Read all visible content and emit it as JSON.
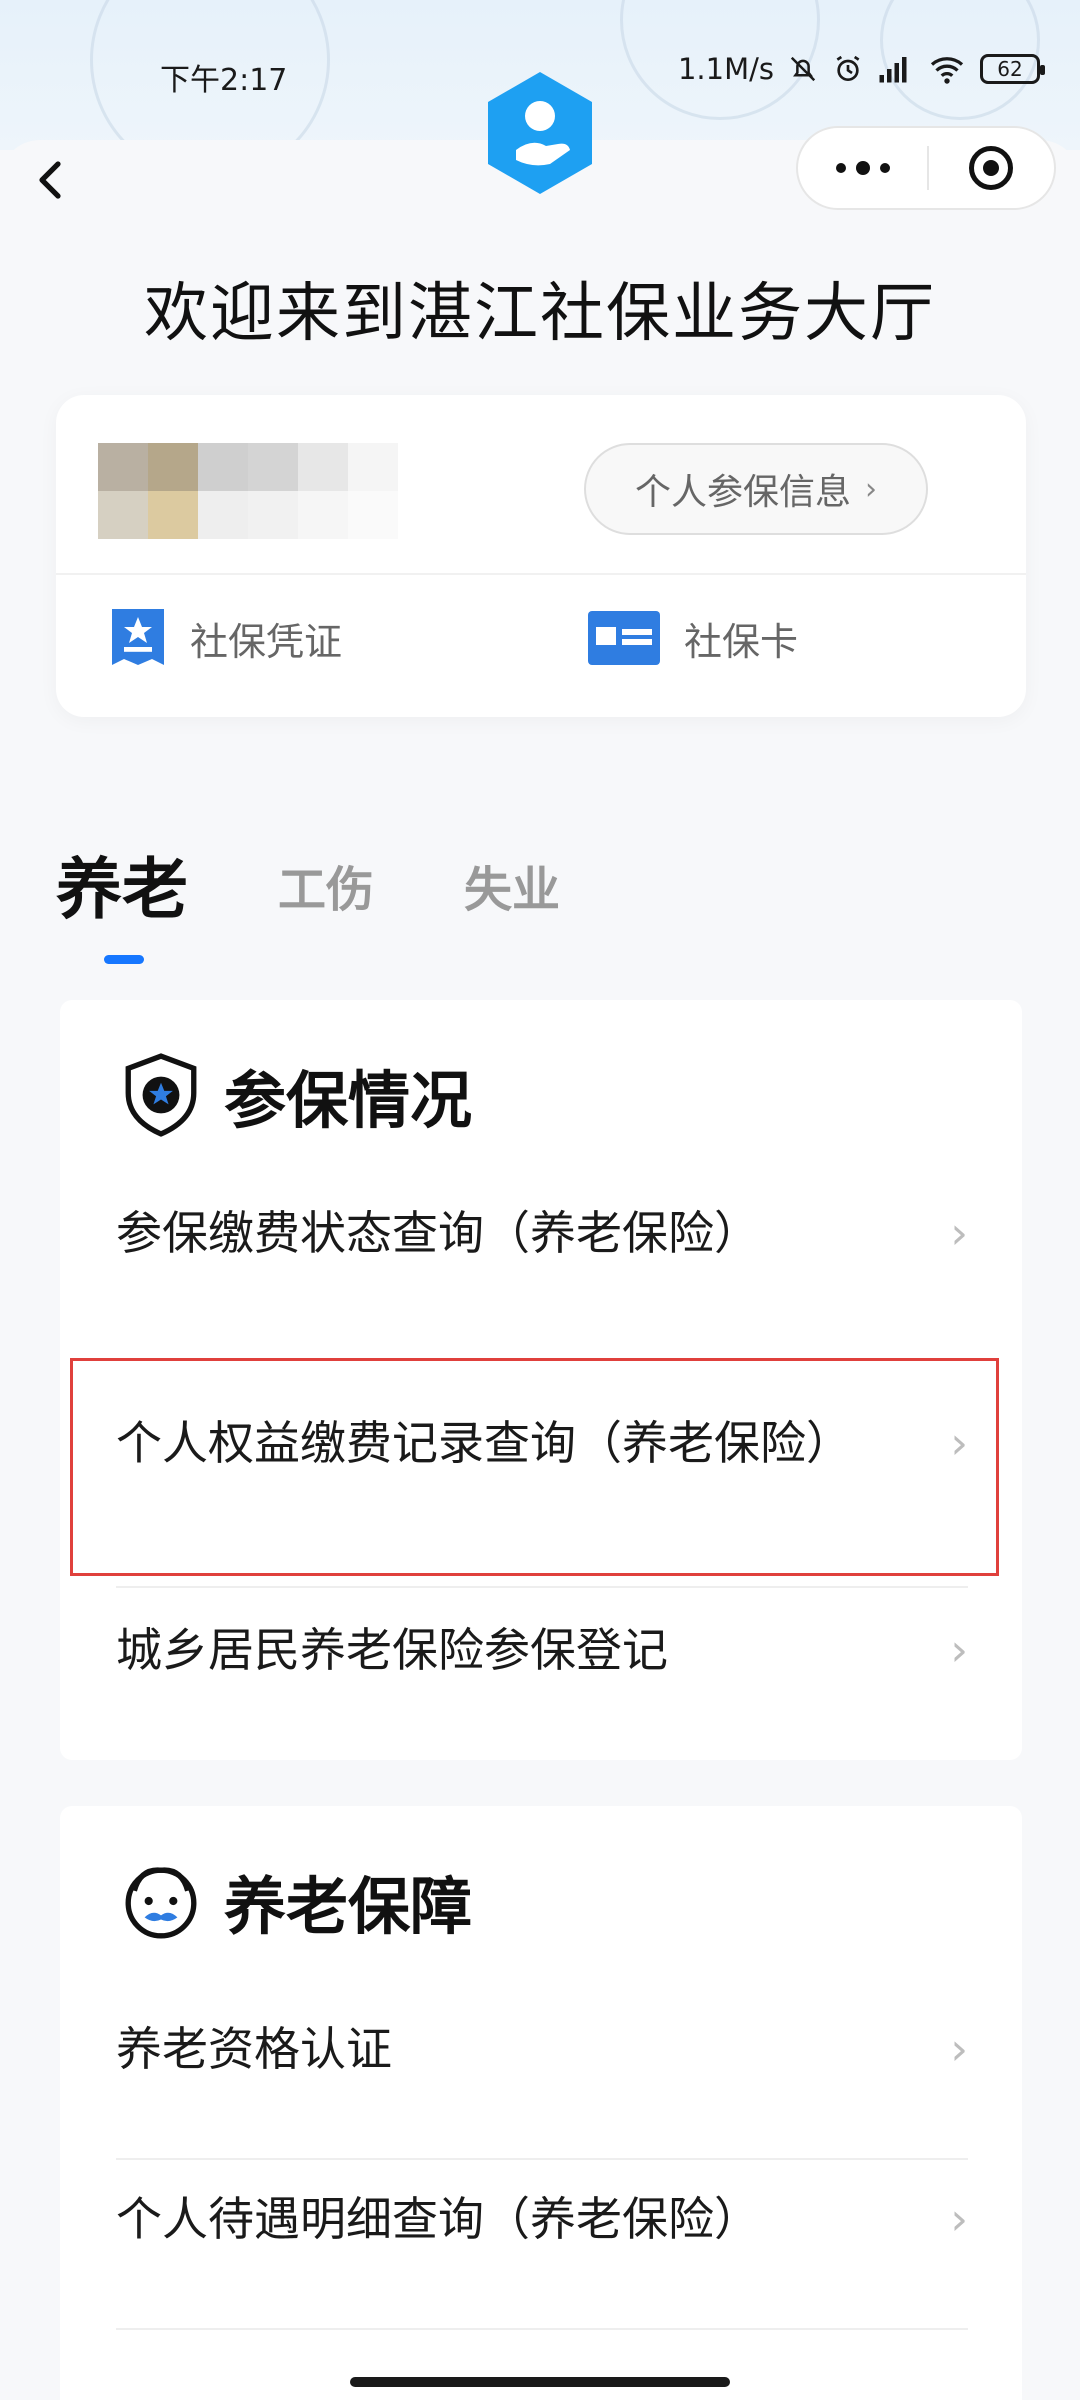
{
  "status_bar": {
    "time": "下午2:17",
    "net_speed": "1.1M/s",
    "battery": "62"
  },
  "nav": {
    "icons": [
      "back-arrow-icon",
      "more-dots-icon",
      "close-target-icon"
    ]
  },
  "header": {
    "title": "欢迎来到湛江社保业务大厅"
  },
  "profile_card": {
    "info_button": "个人参保信息",
    "links": [
      {
        "label": "社保凭证",
        "icon": "voucher-icon"
      },
      {
        "label": "社保卡",
        "icon": "card-icon"
      }
    ]
  },
  "tabs": [
    {
      "label": "养老",
      "active": true
    },
    {
      "label": "工伤",
      "active": false
    },
    {
      "label": "失业",
      "active": false
    }
  ],
  "sections": [
    {
      "title": "参保情况",
      "icon": "shield-star-icon",
      "items": [
        "参保缴费状态查询（养老保险）",
        "个人权益缴费记录查询（养老保险）",
        "城乡居民养老保险参保登记"
      ]
    },
    {
      "title": "养老保障",
      "icon": "elder-face-icon",
      "items": [
        "养老资格认证",
        "个人待遇明细查询（养老保险）"
      ]
    }
  ],
  "colors": {
    "accent": "#1677ff",
    "logo": "#1ea0f2",
    "highlight_border": "#e0403c"
  }
}
